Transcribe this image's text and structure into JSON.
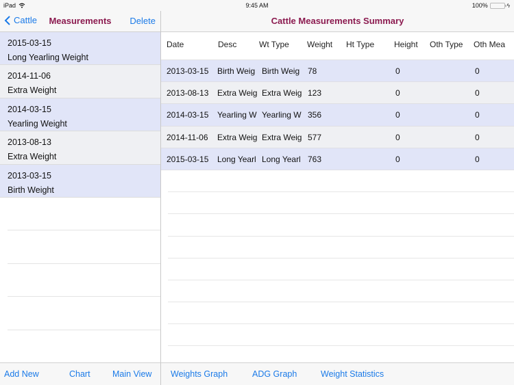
{
  "status_bar": {
    "device": "iPad",
    "time": "9:45 AM",
    "battery": "100%",
    "battery_level_percent": 100
  },
  "master": {
    "back_label": "Cattle",
    "title": "Measurements",
    "right_button": "Delete",
    "items": [
      {
        "date": "2015-03-15",
        "desc": "Long Yearling Weight"
      },
      {
        "date": "2014-11-06",
        "desc": "Extra Weight"
      },
      {
        "date": "2014-03-15",
        "desc": "Yearling Weight"
      },
      {
        "date": "2013-08-13",
        "desc": "Extra Weight"
      },
      {
        "date": "2013-03-15",
        "desc": "Birth Weight"
      }
    ],
    "toolbar": {
      "add_new": "Add New",
      "chart": "Chart",
      "main_view": "Main View"
    }
  },
  "detail": {
    "title": "Cattle Measurements Summary",
    "columns": [
      "Date",
      "Desc",
      "Wt Type",
      "Weight",
      "Ht Type",
      "Height",
      "Oth Type",
      "Oth Mea"
    ],
    "rows": [
      [
        "2013-03-15",
        "Birth Weig",
        "Birth Weig",
        "78",
        "",
        "0",
        "",
        "0"
      ],
      [
        "2013-08-13",
        "Extra Weig",
        "Extra Weig",
        "123",
        "",
        "0",
        "",
        "0"
      ],
      [
        "2014-03-15",
        "Yearling W",
        "Yearling W",
        "356",
        "",
        "0",
        "",
        "0"
      ],
      [
        "2014-11-06",
        "Extra Weig",
        "Extra Weig",
        "577",
        "",
        "0",
        "",
        "0"
      ],
      [
        "2015-03-15",
        "Long Yearl",
        "Long Yearl",
        "763",
        "",
        "0",
        "",
        "0"
      ]
    ],
    "toolbar": {
      "weights_graph": "Weights Graph",
      "adg_graph": "ADG Graph",
      "weight_statistics": "Weight Statistics"
    }
  },
  "colors": {
    "accent": "#1a7ae8",
    "title": "#8b1a4f",
    "row_odd": "#e1e5f8",
    "row_even": "#eff0f3"
  }
}
